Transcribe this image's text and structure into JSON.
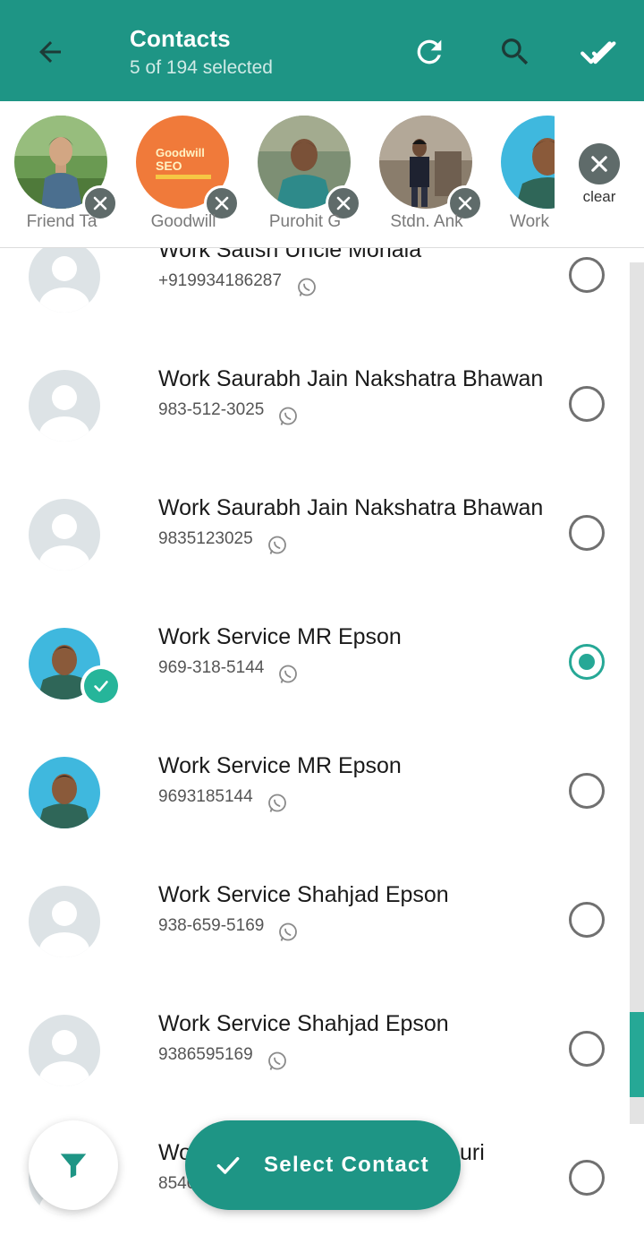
{
  "header": {
    "title": "Contacts",
    "subtitle": "5 of 194 selected",
    "icons": [
      "back-arrow-icon",
      "refresh-icon",
      "search-icon",
      "select-all-icon"
    ],
    "color": "#1e9585"
  },
  "selected": {
    "chips": [
      {
        "name": "Friend Ta"
      },
      {
        "name": "Goodwill",
        "logo_line1": "Goodwill",
        "logo_line2": "SEO"
      },
      {
        "name": "Purohit G"
      },
      {
        "name": "Stdn. Ank"
      },
      {
        "name": "Work"
      }
    ],
    "clear_label": "clear"
  },
  "contacts": [
    {
      "name": "Work Satish Uncle Mohala",
      "phone": "+919934186287",
      "selected": false
    },
    {
      "name": "Work Saurabh Jain Nakshatra Bhawan",
      "phone": "983-512-3025",
      "selected": false
    },
    {
      "name": "Work Saurabh Jain Nakshatra Bhawan",
      "phone": "9835123025",
      "selected": false
    },
    {
      "name": "Work Service MR Epson",
      "phone": "969-318-5144",
      "selected": true
    },
    {
      "name": "Work Service MR Epson",
      "phone": "9693185144",
      "selected": false
    },
    {
      "name": "Work Service Shahjad Epson",
      "phone": "938-659-5169",
      "selected": false
    },
    {
      "name": "Work Service Shahjad Epson",
      "phone": "9386595169",
      "selected": false
    },
    {
      "name_left": "Wo",
      "name_right": "uri",
      "phone": "8540",
      "selected": false
    }
  ],
  "actions": {
    "select_label": "Select Contact",
    "accent": "#26a896"
  }
}
